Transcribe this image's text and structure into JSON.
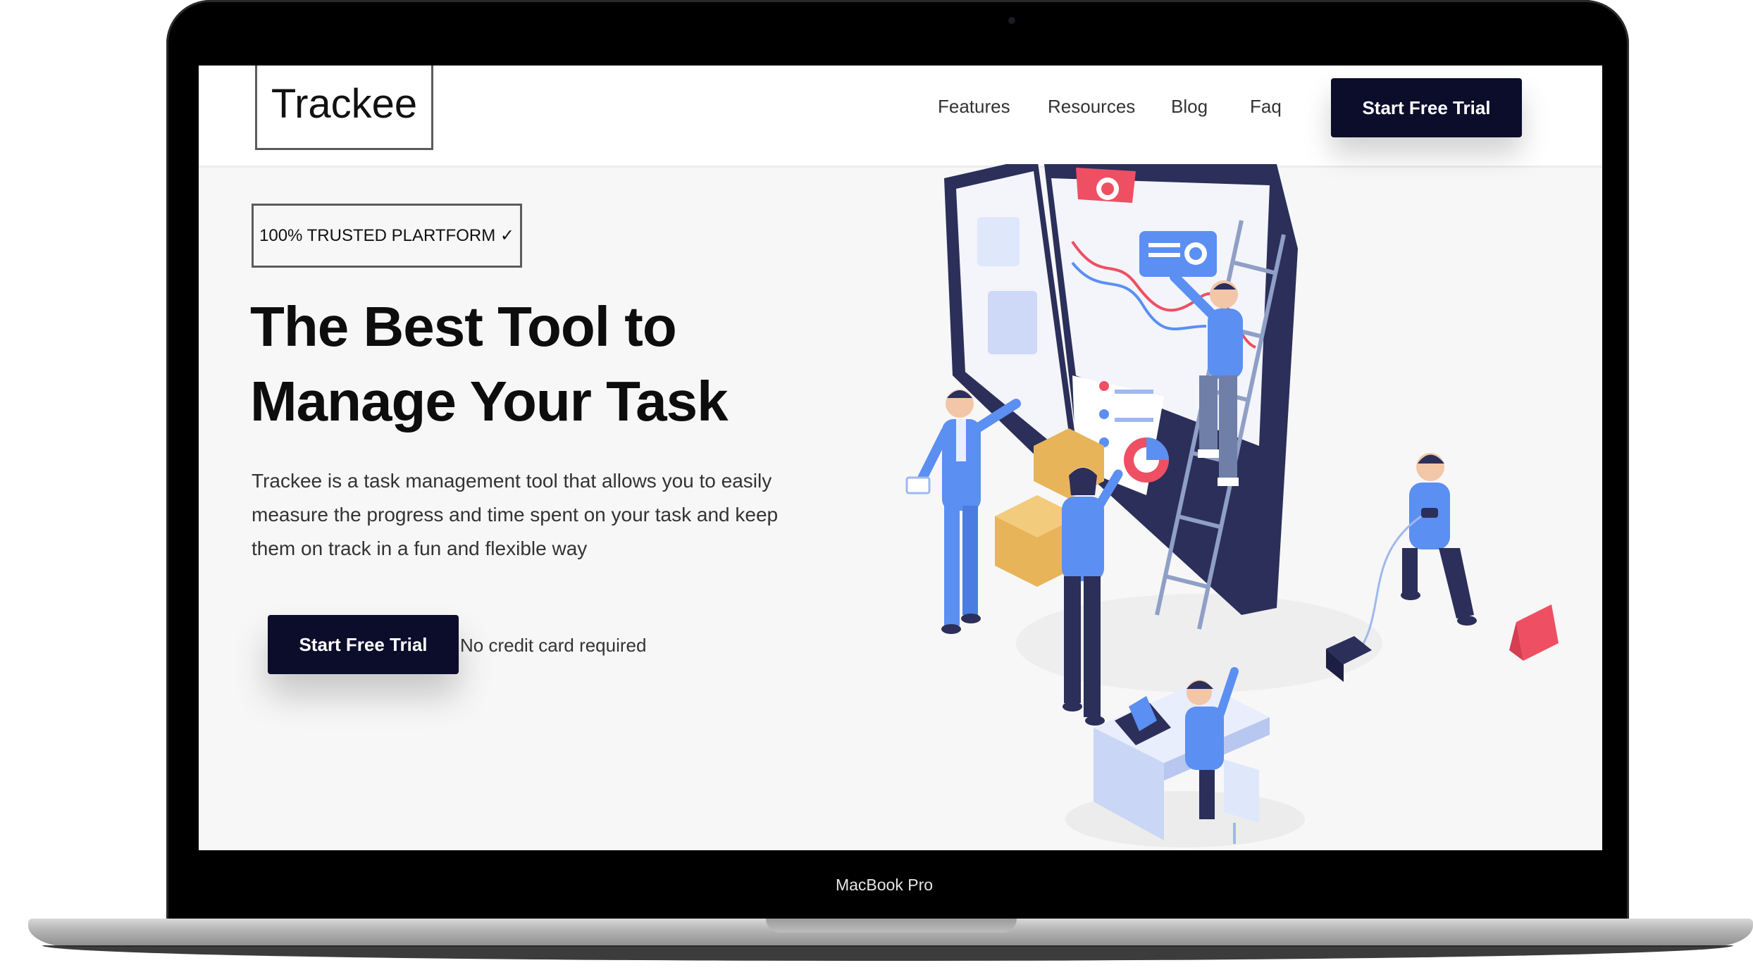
{
  "device": {
    "model_label": "MacBook Pro"
  },
  "header": {
    "logo": "Trackee",
    "nav": [
      "Features",
      "Resources",
      "Blog",
      "Faq"
    ],
    "cta_label": "Start Free Trial"
  },
  "hero": {
    "badge": "100% TRUSTED PLARTFORM ✓",
    "title_line1": "The Best Tool to",
    "title_line2": "Manage Your Task",
    "description": "Trackee is a task management tool that allows you to easily measure the progress and time spent on your task and keep them on track in a fun and flexible way",
    "cta_label": "Start Free Trial",
    "cta_note": "No credit card required"
  },
  "colors": {
    "primary_dark": "#0c0d2b",
    "accent_blue": "#5b8ff2",
    "accent_red": "#ef4f63",
    "box_tan": "#e8b459"
  },
  "icons": [
    "check-icon"
  ]
}
